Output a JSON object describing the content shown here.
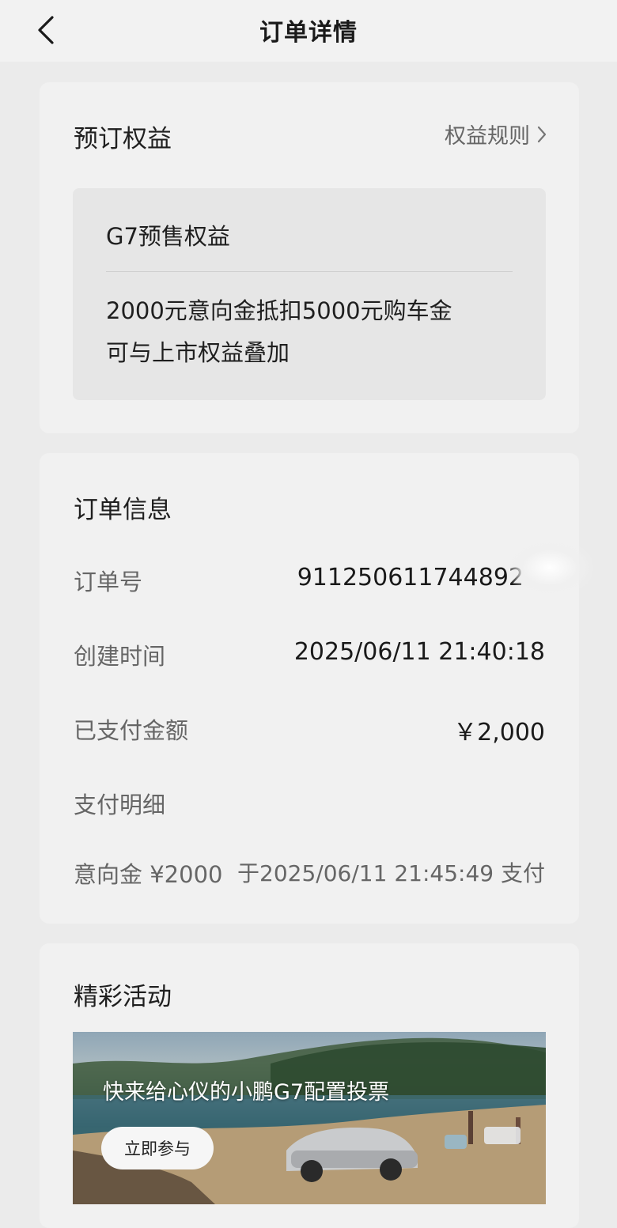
{
  "header": {
    "title": "订单详情"
  },
  "benefits": {
    "title": "预订权益",
    "rules_link": "权益规则",
    "item_name": "G7预售权益",
    "desc_line1": "2000元意向金抵扣5000元购车金",
    "desc_line2": "可与上市权益叠加"
  },
  "order": {
    "title": "订单信息",
    "rows": [
      {
        "label": "订单号",
        "value": "911250611744892"
      },
      {
        "label": "创建时间",
        "value": "2025/06/11 21:40:18"
      },
      {
        "label": "已支付金额",
        "value": "￥2,000"
      },
      {
        "label": "支付明细",
        "value": ""
      }
    ],
    "payment_detail": {
      "label": "意向金 ¥2000",
      "time": "于2025/06/11 21:45:49 支付"
    }
  },
  "activities": {
    "title": "精彩活动",
    "banner_text": "快来给心仪的小鹏G7配置投票",
    "button_label": "立即参与"
  },
  "colors": {
    "background": "#ebebeb",
    "card": "#f1f1f1",
    "benefit_box": "#e6e6e6"
  },
  "icons": {
    "back": "chevron-left-icon",
    "rules": "chevron-right-icon"
  }
}
